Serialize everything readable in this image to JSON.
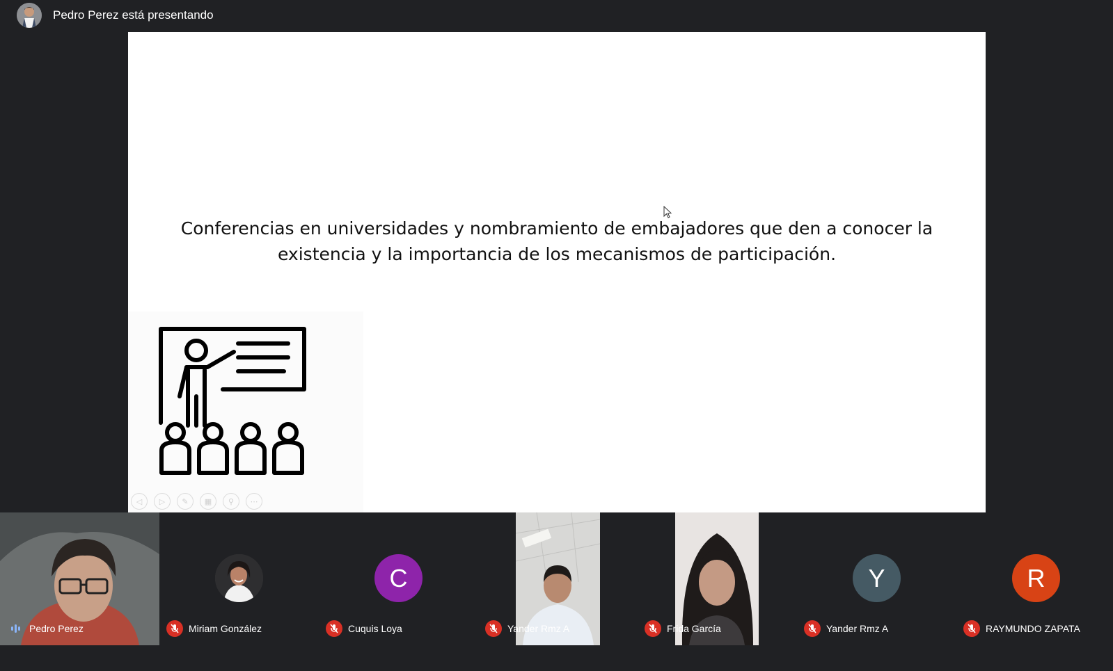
{
  "header": {
    "presenter_status": "Pedro Perez está presentando"
  },
  "slide": {
    "line1": "Conferencias en universidades y nombramiento de embajadores que den a conocer la",
    "line2": "existencia y la importancia de los mecanismos de participación.",
    "controls": [
      {
        "icon": "previous-slide-icon",
        "glyph": "◁"
      },
      {
        "icon": "next-slide-icon",
        "glyph": "▷"
      },
      {
        "icon": "pen-icon",
        "glyph": "✎"
      },
      {
        "icon": "slides-grid-icon",
        "glyph": "▦"
      },
      {
        "icon": "zoom-icon",
        "glyph": "⚲"
      },
      {
        "icon": "more-options-icon",
        "glyph": "⋯"
      }
    ]
  },
  "participants": [
    {
      "name": "Pedro Perez",
      "status": "speaking",
      "display": "video"
    },
    {
      "name": "Miriam González",
      "status": "muted",
      "display": "photo"
    },
    {
      "name": "Cuquis Loya",
      "status": "muted",
      "display": "initial",
      "initial": "C",
      "color": "#8e24aa"
    },
    {
      "name": "Yander Rmz A",
      "status": "muted",
      "display": "video"
    },
    {
      "name": "Frida García",
      "status": "muted",
      "display": "video"
    },
    {
      "name": "Yander Rmz A",
      "status": "muted",
      "display": "initial",
      "initial": "Y",
      "color": "#455a64"
    },
    {
      "name": "RAYMUNDO ZAPATA",
      "status": "muted",
      "display": "initial",
      "initial": "R",
      "color": "#d84315"
    }
  ]
}
